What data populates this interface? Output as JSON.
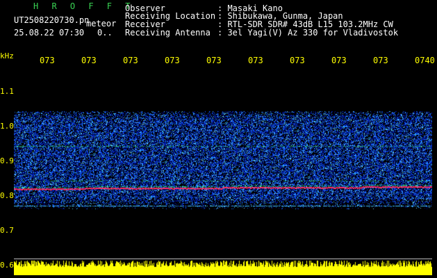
{
  "header": {
    "title": "H R O F F T",
    "filename": "UT2508220730.pn",
    "meteor_label": "meteor",
    "datetime": "25.08.22 07:30",
    "count": "0..",
    "observer_label": "Observer",
    "observer_value": ": Masaki Kano",
    "location_label": "Receiving Location",
    "location_value": ": Shibukawa, Gunma, Japan",
    "receiver_label": "Receiver",
    "receiver_value": ": RTL-SDR SDR# 43dB L15 103.2MHz CW",
    "antenna_label": "Receiving Antenna",
    "antenna_value": ": 3el Yagi(V) Az 330 for Vladivostok"
  },
  "axis": {
    "y_unit": "kHz",
    "y_ticks": [
      "1.1",
      "1.0",
      "0.9",
      "0.8",
      "0.7",
      "0.6"
    ],
    "x_ticks": [
      "073",
      "073",
      "073",
      "073",
      "073",
      "073",
      "073",
      "073",
      "073",
      "0740"
    ]
  },
  "colors": {
    "background": "#000000",
    "noise_dark": "#0010a0",
    "noise_mid": "#1060ff",
    "noise_light": "#40c0ff",
    "signal_green": "#30e060",
    "signal_red": "#ff3060",
    "histogram": "#ffff00"
  }
}
